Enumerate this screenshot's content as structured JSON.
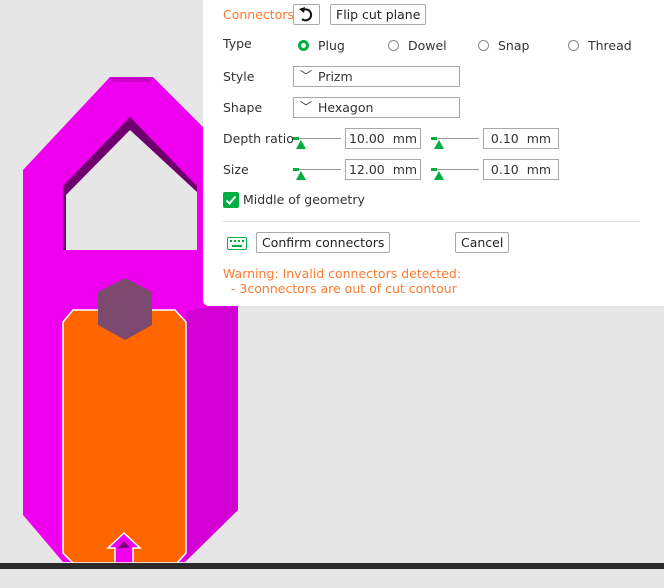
{
  "connectors_panel": {
    "title": "Connectors",
    "flip_cut_plane_label": "Flip cut plane",
    "type_label": "Type",
    "types": [
      {
        "label": "Plug",
        "selected": true
      },
      {
        "label": "Dowel",
        "selected": false
      },
      {
        "label": "Snap",
        "selected": false
      },
      {
        "label": "Thread",
        "selected": false
      }
    ],
    "style_label": "Style",
    "style_value": "Prizm",
    "shape_label": "Shape",
    "shape_value": "Hexagon",
    "depth_ratio_label": "Depth ratio",
    "depth_ratio_value": "10.00",
    "depth_ratio_tolerance": "0.10",
    "size_label": "Size",
    "size_value": "12.00",
    "size_tolerance": "0.10",
    "unit": "mm",
    "middle_of_geometry_label": "Middle of geometry",
    "middle_of_geometry_checked": true,
    "confirm_label": "Confirm connectors",
    "cancel_label": "Cancel",
    "warning_line1": "Warning: Invalid connectors detected:",
    "warning_line2": "  - 3connectors are out of cut contour"
  },
  "colors": {
    "accent": "#ff7a2e",
    "green": "#00ae42",
    "model_magenta": "#ee00ee",
    "model_dark": "#7a007a",
    "cut_part": "#ff6600",
    "connector_hex": "#7b4a6e"
  },
  "icons": [
    "undo-icon",
    "keyboard-icon",
    "chevron-down-icon",
    "checkmark-icon",
    "arrow-up-icon"
  ]
}
